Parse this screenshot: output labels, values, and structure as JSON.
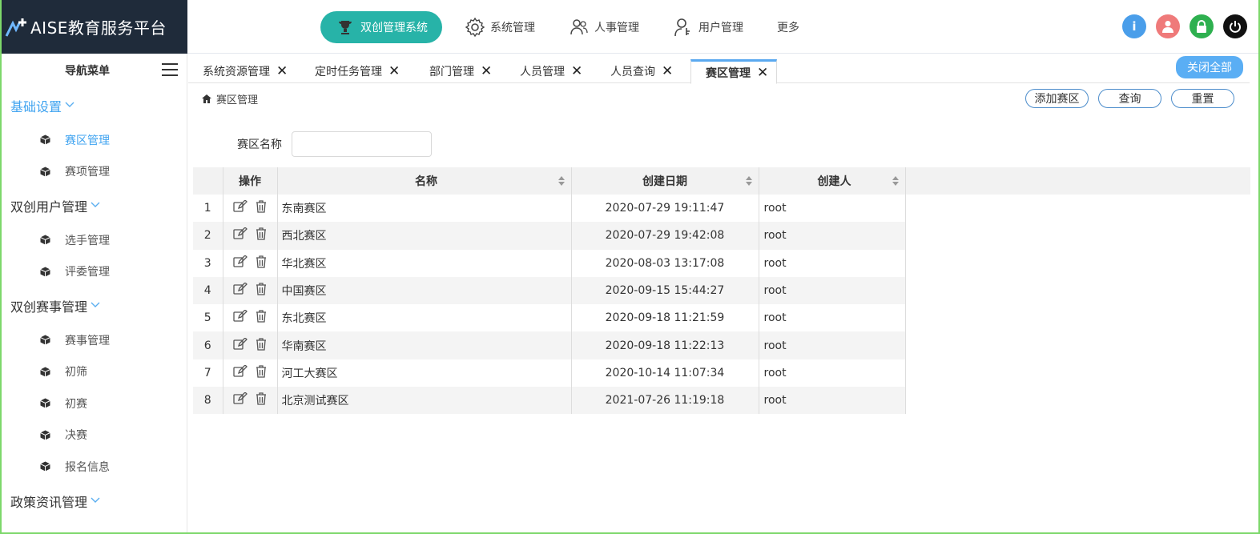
{
  "app": {
    "logo_text": "AISE教育服务平台"
  },
  "topnav": [
    {
      "label": "双创管理系统",
      "icon": "trophy-icon",
      "active": true
    },
    {
      "label": "系统管理",
      "icon": "gear-icon"
    },
    {
      "label": "人事管理",
      "icon": "users-icon"
    },
    {
      "label": "用户管理",
      "icon": "user-key-icon"
    },
    {
      "label": "更多",
      "icon": ""
    }
  ],
  "header_icons": [
    {
      "name": "info-icon",
      "color": "#4a9eea"
    },
    {
      "name": "user-icon",
      "color": "#ef7a7a"
    },
    {
      "name": "lock-icon",
      "color": "#2eb04f"
    },
    {
      "name": "power-icon",
      "color": "#111111"
    }
  ],
  "sidebar": {
    "title": "导航菜单",
    "groups": [
      {
        "label": "基础设置",
        "active": true,
        "items": [
          "赛区管理",
          "赛项管理"
        ]
      },
      {
        "label": "双创用户管理",
        "items": [
          "选手管理",
          "评委管理"
        ]
      },
      {
        "label": "双创赛事管理",
        "items": [
          "赛事管理",
          "初筛",
          "初赛",
          "决赛",
          "报名信息"
        ]
      },
      {
        "label": "政策资讯管理",
        "items": []
      }
    ]
  },
  "tabs": [
    {
      "label": "系统资源管理"
    },
    {
      "label": "定时任务管理"
    },
    {
      "label": "部门管理"
    },
    {
      "label": "人员管理"
    },
    {
      "label": "人员查询"
    },
    {
      "label": "赛区管理",
      "active": true
    }
  ],
  "close_all_label": "关闭全部",
  "breadcrumb": "赛区管理",
  "actions": {
    "add": "添加赛区",
    "query": "查询",
    "reset": "重置"
  },
  "filter": {
    "label": "赛区名称",
    "value": ""
  },
  "table": {
    "headers": {
      "op": "操作",
      "name": "名称",
      "date": "创建日期",
      "user": "创建人"
    },
    "rows": [
      {
        "idx": "1",
        "name": "东南赛区",
        "date": "2020-07-29 19:11:47",
        "user": "root"
      },
      {
        "idx": "2",
        "name": "西北赛区",
        "date": "2020-07-29 19:42:08",
        "user": "root"
      },
      {
        "idx": "3",
        "name": "华北赛区",
        "date": "2020-08-03 13:17:08",
        "user": "root"
      },
      {
        "idx": "4",
        "name": "中国赛区",
        "date": "2020-09-15 15:44:27",
        "user": "root"
      },
      {
        "idx": "5",
        "name": "东北赛区",
        "date": "2020-09-18 11:21:59",
        "user": "root"
      },
      {
        "idx": "6",
        "name": "华南赛区",
        "date": "2020-09-18 11:22:13",
        "user": "root"
      },
      {
        "idx": "7",
        "name": "河工大赛区",
        "date": "2020-10-14 11:07:34",
        "user": "root"
      },
      {
        "idx": "8",
        "name": "北京测试赛区",
        "date": "2021-07-26 11:19:18",
        "user": "root"
      }
    ]
  }
}
